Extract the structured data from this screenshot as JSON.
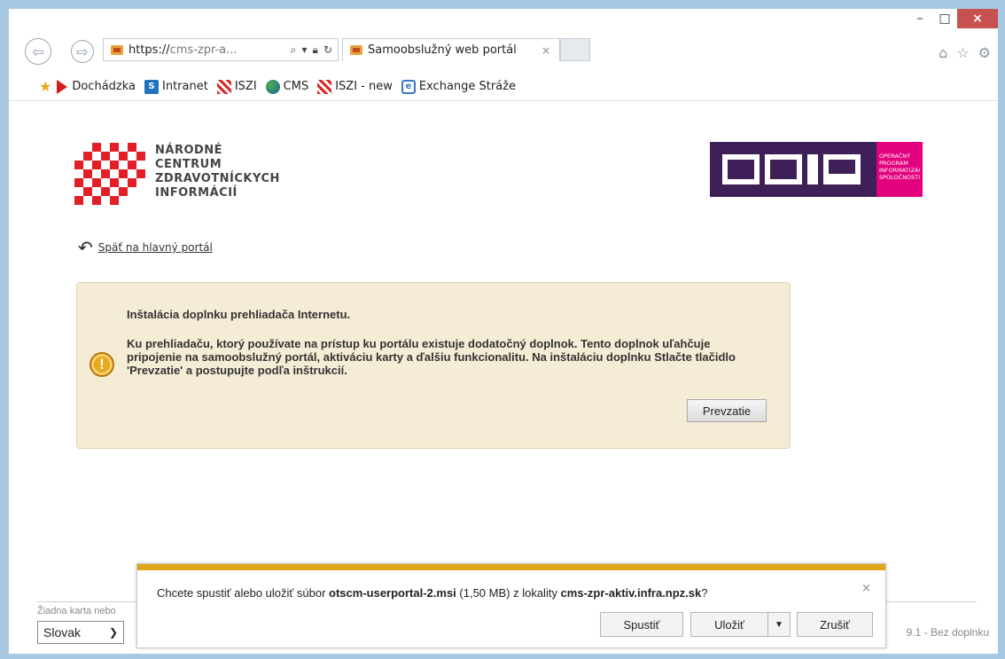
{
  "window": {
    "minimize_glyph": "–",
    "maximize_glyph": "□",
    "close_glyph": "×"
  },
  "browser": {
    "address": {
      "prefix": "https://",
      "host": "cms-zpr-a..."
    },
    "tab": {
      "title": "Samoobslužný web portál",
      "close_glyph": "×"
    },
    "icons": [
      "home-icon",
      "favorites-star-icon",
      "settings-gear-icon"
    ]
  },
  "favorites": [
    {
      "label": "Dochádzka",
      "icon": "play-icon"
    },
    {
      "label": "Intranet",
      "icon": "sharepoint-icon"
    },
    {
      "label": "ISZI",
      "icon": "iszi-icon"
    },
    {
      "label": "CMS",
      "icon": "globe-icon"
    },
    {
      "label": "ISZI - new",
      "icon": "iszi-icon"
    },
    {
      "label": "Exchange Stráže",
      "icon": "ie-page-icon"
    }
  ],
  "page": {
    "nczi": {
      "line1": "NÁRODNÉ",
      "line2": "CENTRUM",
      "line3": "ZDRAVOTNÍCKYCH",
      "line4": "INFORMÁCIÍ"
    },
    "oois": {
      "side1": "OPERAČNÝ",
      "side2": "PROGRAM",
      "side3": "INFORMATIZÁCIA",
      "side4": "SPOLOČNOSTI"
    },
    "back_link": "Späť na hlavný portál",
    "notice": {
      "title": "Inštalácia doplnku prehliadača Internetu.",
      "body": "Ku prehliadaču, ktorý používate na prístup ku portálu existuje dodatočný doplnok. Tento doplnok uľahčuje pripojenie na samoobslužný portál, aktiváciu karty a ďalšiu funkcionalitu. Na inštaláciu doplnku Stlačte tlačidlo 'Prevzatie' a postupujte podľa inštrukcií.",
      "button": "Prevzatie"
    },
    "footer": {
      "status": "Žiadna karta nebo",
      "language": "Slovak",
      "version": "9.1 - Bez doplnku"
    }
  },
  "download": {
    "msg_pre": "Chcete spustiť alebo uložiť súbor ",
    "filename": "otscm-userportal-2.msi",
    "msg_mid": " (1,50 MB) z lokality ",
    "site": "cms-zpr-aktiv.infra.npz.sk",
    "msg_post": "?",
    "run": "Spustiť",
    "save": "Uložiť",
    "cancel": "Zrušiť",
    "close_glyph": "×"
  },
  "colors": {
    "notice_bg": "#f5ecd5",
    "accent": "#e0a61e",
    "nczi_red": "#e21f26",
    "oois_purple": "#3f1f58",
    "oois_pink": "#e3007d"
  }
}
